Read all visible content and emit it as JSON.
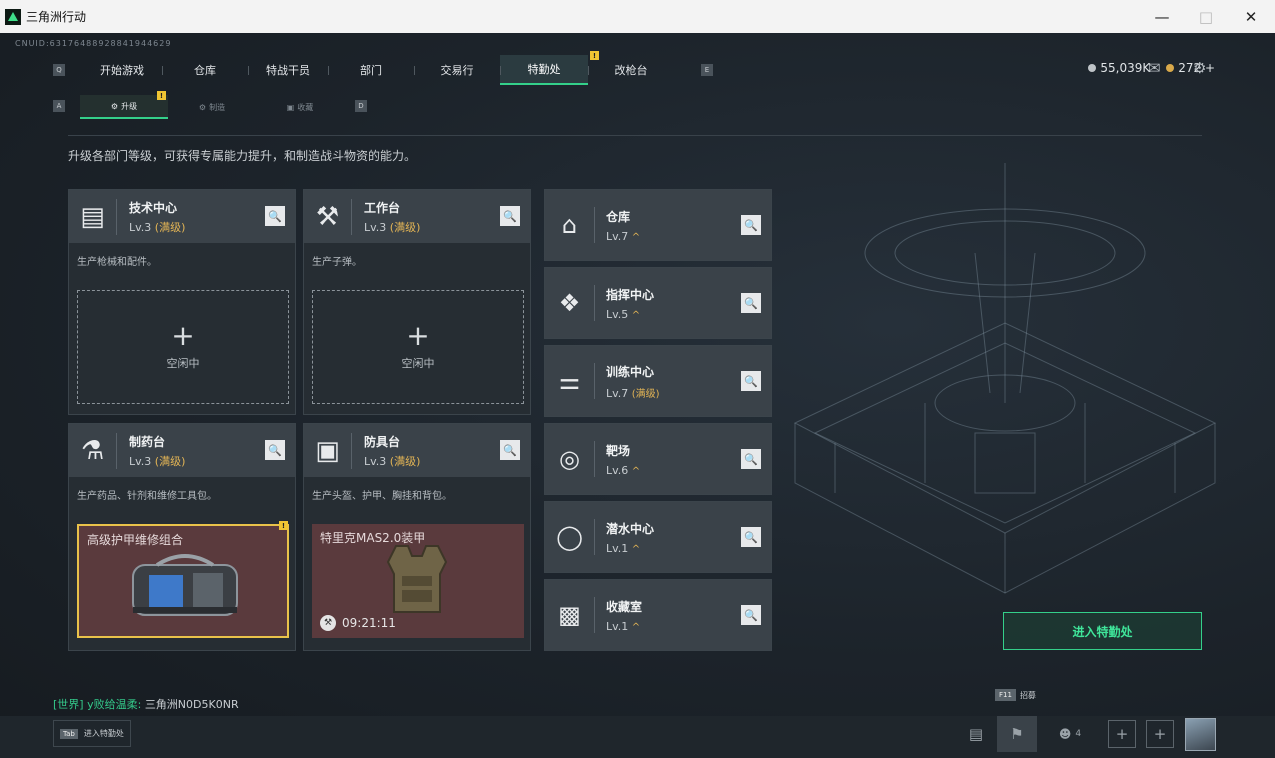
{
  "window": {
    "title": "三角洲行动"
  },
  "header": {
    "cnuid": "CNUID:6317648892884194462​9",
    "nav_tabs": [
      "开始游戏",
      "仓库",
      "特战干员",
      "部门",
      "交易行",
      "特勤处",
      "改枪台"
    ],
    "active_tab": "特勤处",
    "key_left": "Q",
    "key_right": "E",
    "badge": "!",
    "currency": {
      "silver": "55,039K",
      "gold": "272 +"
    }
  },
  "subnav": {
    "key_left": "A",
    "key_right": "D",
    "tabs": [
      "升级",
      "制造",
      "收藏"
    ]
  },
  "description": "升级各部门等级，可获得专属能力提升，和制造战斗物资的能力。",
  "stations": [
    {
      "name": "技术中心",
      "level": "Lv.3",
      "max": "(满级)",
      "desc": "生产枪械和配件。",
      "status": "空闲中"
    },
    {
      "name": "工作台",
      "level": "Lv.3",
      "max": "(满级)",
      "desc": "生产子弹。",
      "status": "空闲中"
    },
    {
      "name": "制药台",
      "level": "Lv.3",
      "max": "(满级)",
      "desc": "生产药品、针剂和维修工具包。",
      "craft": "高级护甲维修组合"
    },
    {
      "name": "防具台",
      "level": "Lv.3",
      "max": "(满级)",
      "desc": "生产头盔、护甲、胸挂和背包。",
      "craft": "特里克MAS2.0装甲",
      "timer": "09:21:11"
    }
  ],
  "facilities": [
    {
      "name": "仓库",
      "level": "Lv.7",
      "tag": "^"
    },
    {
      "name": "指挥中心",
      "level": "Lv.5",
      "tag": "^"
    },
    {
      "name": "训练中心",
      "level": "Lv.7",
      "tag": "(满级)"
    },
    {
      "name": "靶场",
      "level": "Lv.6",
      "tag": "^"
    },
    {
      "name": "潜水中心",
      "level": "Lv.1",
      "tag": "^"
    },
    {
      "name": "收藏室",
      "level": "Lv.1",
      "tag": "^"
    }
  ],
  "enter_button": "进入特勤处",
  "chat": {
    "channel": "[世界]",
    "user": "y败给温柔:",
    "message": "三角洲N0D5K0NR"
  },
  "bottom": {
    "tab_key": "Tab",
    "tab_label": "进入特勤处",
    "f11_key": "F11",
    "f11_label": "招募",
    "friends": "4"
  }
}
